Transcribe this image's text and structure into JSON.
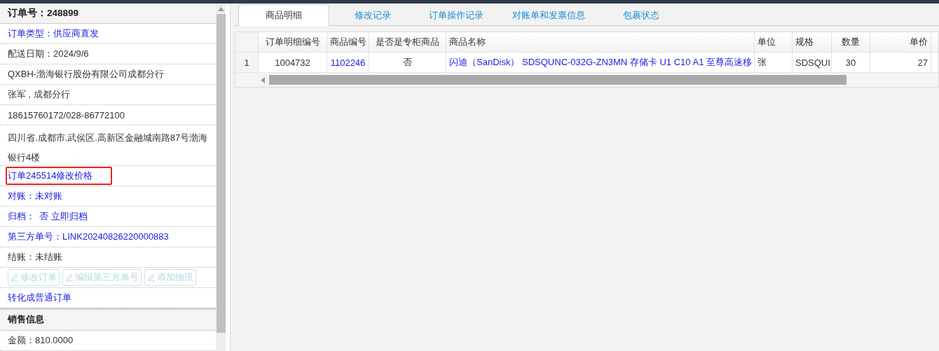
{
  "order_panel": {
    "title": "订单号：248899",
    "rows": [
      {
        "kind": "link",
        "text": "订单类型：供应商直发"
      },
      {
        "kind": "text",
        "text": "配送日期：2024/9/6"
      },
      {
        "kind": "text",
        "text": "QXBH-渤海银行股份有限公司成都分行"
      },
      {
        "kind": "text",
        "text": "张军 , 成都分行"
      },
      {
        "kind": "text",
        "text": "18615760172/028-86772100"
      },
      {
        "kind": "text",
        "text": "四川省.成都市.武侯区.高新区金融城南路87号渤海银行4楼"
      },
      {
        "kind": "link",
        "text": "订单245514修改价格",
        "highlighted": true
      },
      {
        "kind": "link",
        "text": "对账：未对账"
      },
      {
        "kind": "archive",
        "text": "归档：",
        "value": "否",
        "action": "立即归档"
      },
      {
        "kind": "link",
        "text": "第三方单号：LINK20240826220000883"
      },
      {
        "kind": "text",
        "text": "结账：未结账"
      },
      {
        "kind": "buttons",
        "buttons": [
          {
            "label": "修改订单",
            "disabled": true
          },
          {
            "label": "编辑第三方单号",
            "disabled": true
          },
          {
            "label": "添加物流",
            "disabled": true
          }
        ]
      },
      {
        "kind": "link",
        "text": "转化成普通订单"
      }
    ],
    "section": {
      "title": "销售信息",
      "rows": [
        {
          "text": "金额：810.0000"
        }
      ]
    }
  },
  "tabs": [
    {
      "label": "商品明细",
      "selected": true
    },
    {
      "label": "修改记录",
      "selected": false
    },
    {
      "label": "订单操作记录",
      "selected": false
    },
    {
      "label": "对账单和发票信息",
      "selected": false
    },
    {
      "label": "包裹状态",
      "selected": false
    }
  ],
  "table": {
    "columns": [
      "订单明细编号",
      "商品编号",
      "是否是专柜商品",
      "商品名称",
      "单位",
      "规格",
      "数量",
      "单价"
    ],
    "rows": [
      {
        "index": "1",
        "cells": [
          "1004732",
          "1102246",
          "否",
          "闪迪（SanDisk） SDSQUNC-032G-ZN3MN 存储卡 U1 C10 A1 至尊高速移",
          "张",
          "SDSQUI",
          "30",
          "27"
        ]
      }
    ]
  }
}
